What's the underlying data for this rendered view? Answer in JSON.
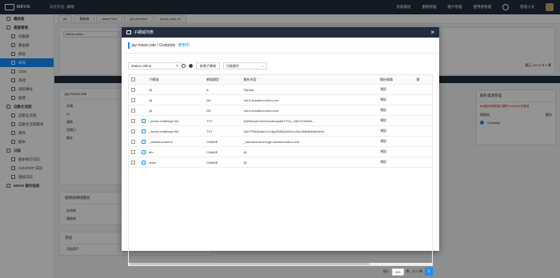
{
  "topbar": {
    "logo": "MRVN",
    "breadcrumb_parent": "資產管理",
    "breadcrumb_sep": " / ",
    "breadcrumb_current": "網域",
    "nav": [
      "系統資訊",
      "服務管理",
      "帳戶管理",
      "使用者管理"
    ],
    "user": "管理十天"
  },
  "sidebar": {
    "items": [
      {
        "label": "儀表板",
        "type": "group"
      },
      {
        "label": "資產管理",
        "type": "group"
      },
      {
        "label": "伺服器",
        "type": "sub"
      },
      {
        "label": "路由器",
        "type": "sub"
      },
      {
        "label": "網段",
        "type": "sub"
      },
      {
        "label": "網域",
        "type": "active"
      },
      {
        "label": "CDN",
        "type": "sub"
      },
      {
        "label": "憑證",
        "type": "sub"
      },
      {
        "label": "域名轉址",
        "type": "sub"
      },
      {
        "label": "服務",
        "type": "sub"
      },
      {
        "label": "自動化流程",
        "type": "group"
      },
      {
        "label": "自動化流程",
        "type": "sub"
      },
      {
        "label": "自動化流程範本",
        "type": "sub"
      },
      {
        "label": "事件",
        "type": "sub"
      },
      {
        "label": "腳本",
        "type": "sub"
      },
      {
        "label": "日誌",
        "type": "group"
      },
      {
        "label": "腳本執行日誌",
        "type": "sub"
      },
      {
        "label": "SSH/RDP 日誌",
        "type": "sub"
      },
      {
        "label": "稽核日誌",
        "type": "sub"
      },
      {
        "label": "MRVN 操作指南",
        "type": "group"
      }
    ]
  },
  "bg_tabs": [
    "All",
    "服務商",
    "Asset Test",
    "QA-checklist",
    "luxury_test_ch"
  ],
  "bg": {
    "search": "status:online",
    "detail_title": "jay-mavis.site",
    "labels": [
      "名稱",
      "ID",
      "服務",
      "到期日",
      "備註"
    ],
    "sec1": "服務商網域資訊",
    "sec1_labels": [
      "註冊商",
      "服務商"
    ],
    "sec2": "其他",
    "sec2_label": "添加用戶",
    "right_title": "解析資源管理",
    "right_warn": "■ 服務商帳號僅可選擇 Godaddy 的帳號",
    "right_label": "服務商",
    "right_val": "Godaddy",
    "right_col": "解析",
    "page_info": "顯示 100 ▾ 共 5 筆"
  },
  "modal": {
    "title": "子網域列表",
    "domain": "jay-mavis.site / Godaddy",
    "status": "使用中",
    "search_value": "status:online",
    "add_button": "新增子網域",
    "batch_select": "功能操作",
    "columns": [
      "子網域",
      "網域類型",
      "解析內容",
      "解析線路",
      "解"
    ],
    "rows": [
      {
        "host": "@",
        "type": "A",
        "value": "Parked",
        "line": "預設",
        "edit": false
      },
      {
        "host": "@",
        "type": "NS",
        "value": "ns13.domaincontrol.com",
        "line": "預設",
        "edit": false
      },
      {
        "host": "@",
        "type": "NS",
        "value": "ns14.domaincontrol.com",
        "line": "預設",
        "edit": false
      },
      {
        "host": "_acme-challenge.tim",
        "type": "TXT",
        "value": "84hNeupb.ufzGaLeatoopaN7YGo_4aDYGmiIMs...",
        "line": "預設",
        "edit": true
      },
      {
        "host": "_acme-challenge.tim",
        "type": "TXT",
        "value": "Z4cYP8sZwamLCc4gJ0M8Qch5cUrZwLkAfwBfwAHoHw",
        "line": "預設",
        "edit": true
      },
      {
        "host": "_domainconnect",
        "type": "CNAME",
        "value": "_domainconnect.gd.domaincontrol.com",
        "line": "預設",
        "edit": true
      },
      {
        "host": "tim",
        "type": "CNAME",
        "value": "@",
        "line": "預設",
        "edit": true
      },
      {
        "host": "www",
        "type": "CNAME",
        "value": "@",
        "line": "預設",
        "edit": true
      }
    ],
    "footer_show": "顯示",
    "footer_size": "100",
    "footer_total": "筆，共 8 筆",
    "footer_page": "1"
  }
}
